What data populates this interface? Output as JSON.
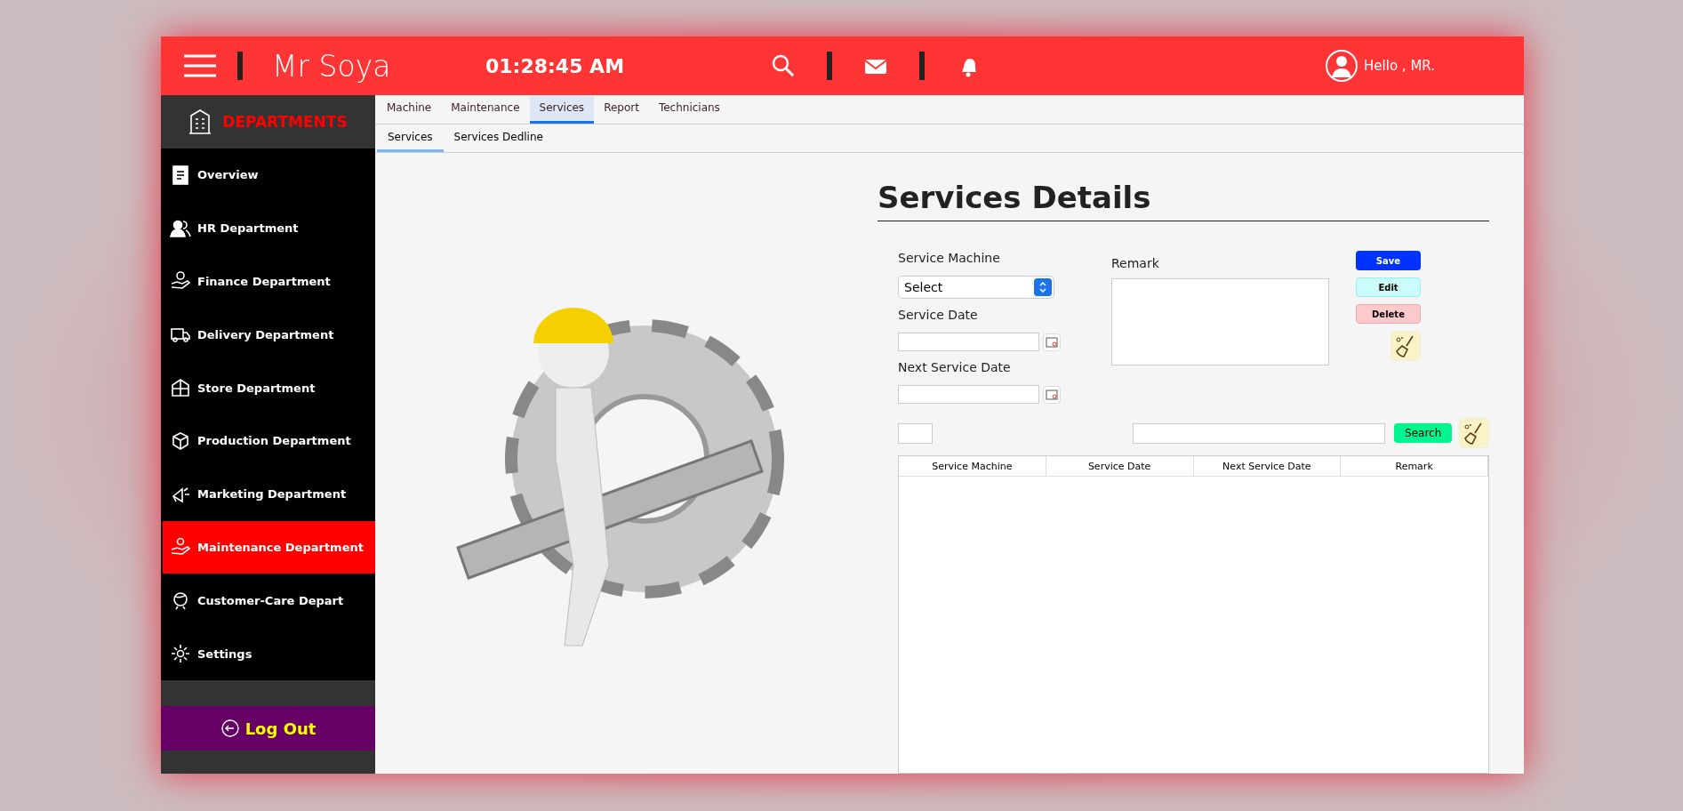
{
  "header": {
    "brand": "Mr Soya",
    "time": "01:28:45 AM",
    "greeting": "Hello , MR."
  },
  "sidebar": {
    "title": "DEPARTMENTS",
    "items": [
      {
        "label": "Overview",
        "selected": false
      },
      {
        "label": "HR Department",
        "selected": false
      },
      {
        "label": "Finance Department",
        "selected": false
      },
      {
        "label": "Delivery Department",
        "selected": false
      },
      {
        "label": "Store Department",
        "selected": false
      },
      {
        "label": "Production Department",
        "selected": false
      },
      {
        "label": "Marketing Department",
        "selected": false
      },
      {
        "label": "Maintenance Department",
        "selected": true
      },
      {
        "label": "Customer-Care Depart",
        "selected": false
      },
      {
        "label": "Settings",
        "selected": false
      }
    ],
    "logout": "Log Out"
  },
  "tabs": [
    {
      "label": "Machine",
      "selected": false
    },
    {
      "label": "Maintenance",
      "selected": false
    },
    {
      "label": "Services",
      "selected": true
    },
    {
      "label": "Report",
      "selected": false
    },
    {
      "label": "Technicians",
      "selected": false
    }
  ],
  "subtabs": [
    {
      "label": "Services",
      "selected": true
    },
    {
      "label": "Services Dedline",
      "selected": false
    }
  ],
  "form": {
    "title": "Services Details",
    "machine_label": "Service Machine",
    "machine_value": "Select",
    "date_label": "Service Date",
    "next_date_label": "Next Service Date",
    "remark_label": "Remark",
    "buttons": [
      {
        "label": "Save",
        "kind": "save"
      },
      {
        "label": "Edit",
        "kind": "edit"
      },
      {
        "label": "Delete",
        "kind": "delete"
      }
    ],
    "search_button": "Search"
  },
  "table": {
    "columns": [
      "Service Machine",
      "Service Date",
      "Next Service Date",
      "Remark"
    ]
  }
}
